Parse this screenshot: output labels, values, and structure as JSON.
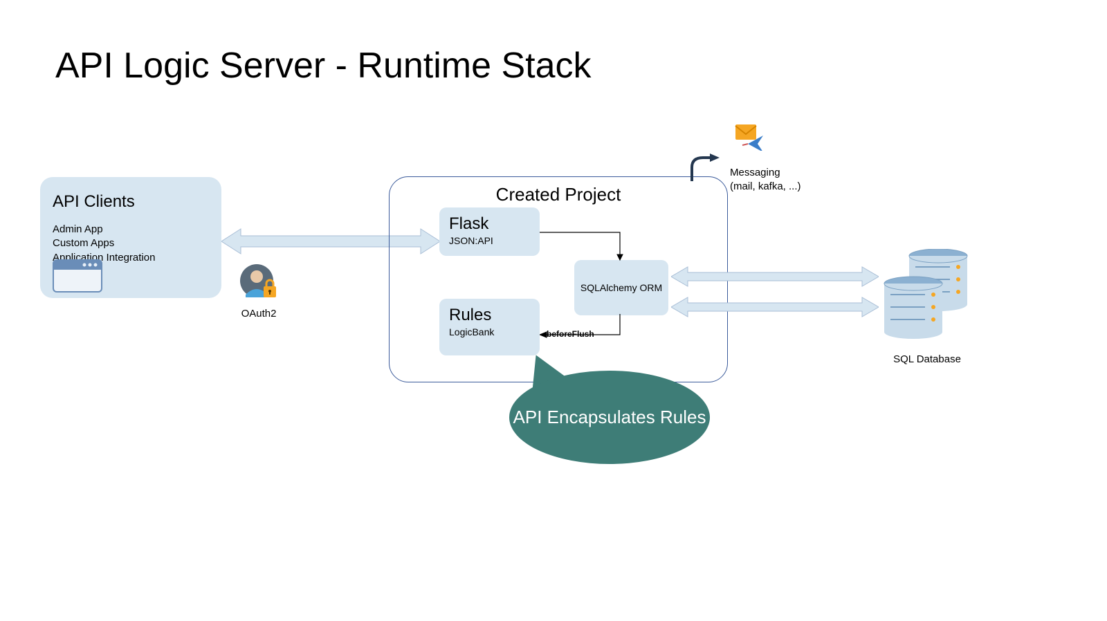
{
  "title": "API Logic Server - Runtime Stack",
  "api_clients": {
    "title": "API Clients",
    "items": [
      "Admin App",
      "Custom Apps",
      "Application Integration"
    ]
  },
  "oauth_label": "OAuth2",
  "created_project": {
    "title": "Created Project",
    "flask": {
      "title": "Flask",
      "subtitle": "JSON:API"
    },
    "rules": {
      "title": "Rules",
      "subtitle": "LogicBank"
    },
    "sqlalchemy": "SQLAlchemy ORM",
    "before_flush": "beforeFlush"
  },
  "callout": "API Encapsulates Rules",
  "messaging": {
    "line1": "Messaging",
    "line2": "(mail, kafka, ...)"
  },
  "database_label": "SQL Database"
}
